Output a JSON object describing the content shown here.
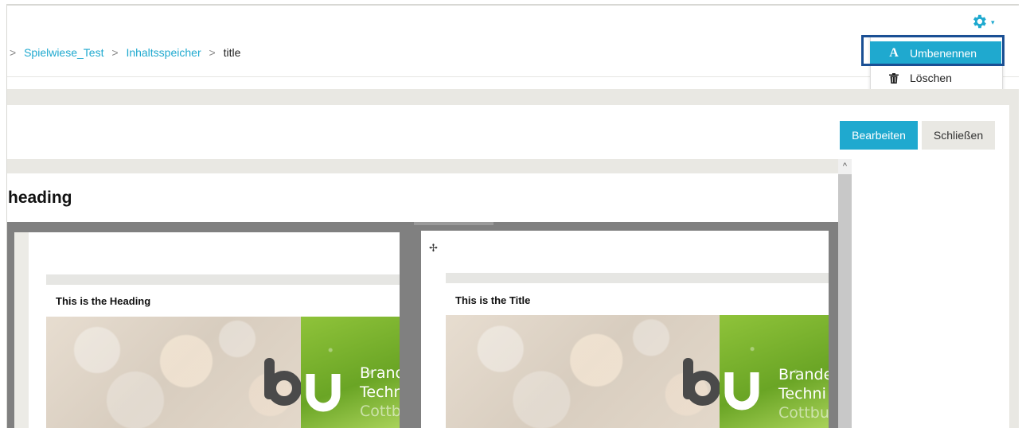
{
  "breadcrumb": {
    "separator": ">",
    "items": [
      "Spielwiese_Test",
      "Inhaltsspeicher"
    ],
    "current": "title"
  },
  "settings": {
    "icon": "gear-icon",
    "caret": "▾",
    "menu": {
      "rename_icon": "A",
      "rename_label": "Umbenennen",
      "delete_icon": "trash-icon",
      "delete_label": "Löschen"
    }
  },
  "toolbar": {
    "edit_label": "Bearbeiten",
    "close_label": "Schließen"
  },
  "content": {
    "heading": "heading",
    "scroll_up": "^",
    "move_icon": "✢",
    "left_card": {
      "title": "This is the Heading",
      "brand_lines": [
        "Brande",
        "Techni",
        "Cottbu"
      ]
    },
    "right_card": {
      "title": "This is the Title",
      "brand_lines": [
        "Brande",
        "Techni",
        "Cottbu"
      ]
    }
  },
  "colors": {
    "accent": "#1fa9cf",
    "highlight_border": "#1a4f94",
    "band": "#e9e8e3"
  }
}
